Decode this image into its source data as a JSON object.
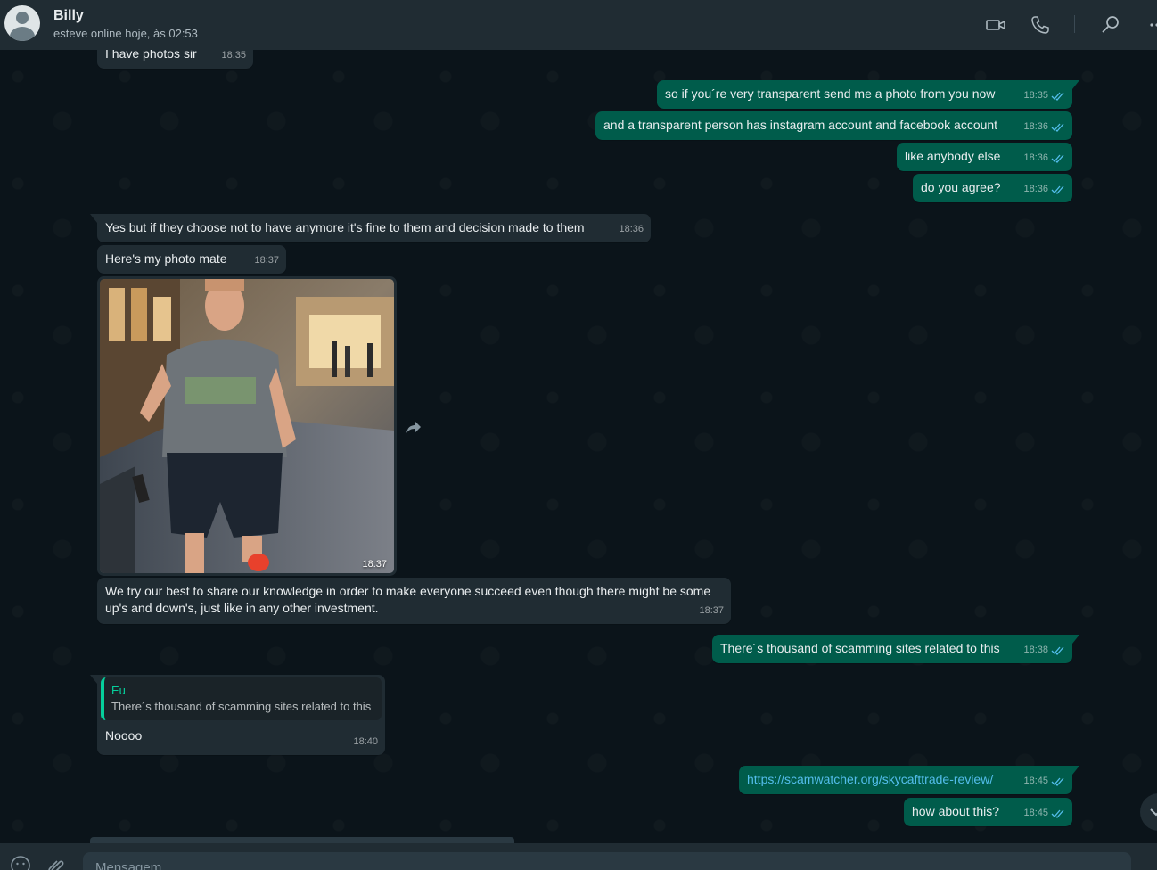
{
  "header": {
    "contact_name": "Billy",
    "status": "esteve online hoje, às 02:53",
    "icons": [
      "video-call-icon",
      "voice-call-icon",
      "search-icon",
      "menu-icon"
    ]
  },
  "messages": [
    {
      "dir": "in",
      "text": "I have photos sir",
      "time": "18:35"
    },
    {
      "dir": "out",
      "text": "so if you´re very transparent send me a photo from you now",
      "time": "18:35"
    },
    {
      "dir": "out",
      "text": "and a transparent person has instagram account and facebook account",
      "time": "18:36"
    },
    {
      "dir": "out",
      "text": "like anybody else",
      "time": "18:36"
    },
    {
      "dir": "out",
      "text": "do you agree?",
      "time": "18:36"
    },
    {
      "dir": "in",
      "text": "Yes but if they choose not to have anymore it's fine to them and decision made to them",
      "time": "18:36"
    },
    {
      "dir": "in",
      "text": "Here's my photo mate",
      "time": "18:37"
    },
    {
      "dir": "in",
      "type": "image",
      "time": "18:37"
    },
    {
      "dir": "in",
      "text_line1": "We try our best to share our knowledge in order to make everyone succeed even though there might be some",
      "text_line2": "up's and down's, just like in any other investment.",
      "time": "18:37"
    },
    {
      "dir": "out",
      "text": "There´s thousand of scamming sites related to this",
      "time": "18:38"
    },
    {
      "dir": "in",
      "quote_author": "Eu",
      "quote_text": "There´s thousand of scamming sites related to this",
      "text": "Noooo",
      "time": "18:40"
    },
    {
      "dir": "out",
      "text": "https://scamwatcher.org/skycafttrade-review/",
      "time": "18:45"
    },
    {
      "dir": "out",
      "text": "how about this?",
      "time": "18:45"
    }
  ],
  "composer": {
    "placeholder": "Mensagem"
  },
  "colors": {
    "incoming_bubble": "#202c33",
    "outgoing_bubble": "#005c4b",
    "background": "#0b141a",
    "read_tick": "#53bdeb"
  }
}
